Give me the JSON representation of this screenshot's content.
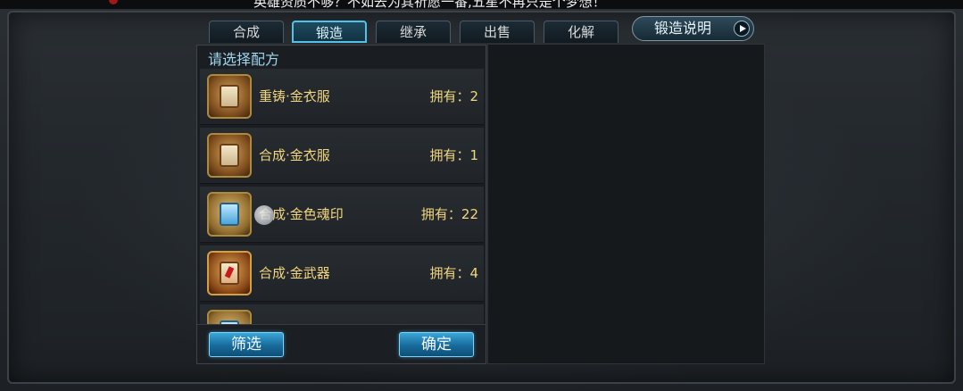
{
  "top_banner": {
    "text": "英雄资质不够？不如去为其祈愿一番,五星不再只是个梦想！"
  },
  "tabs": [
    {
      "label": "合成"
    },
    {
      "label": "锻造"
    },
    {
      "label": "继承"
    },
    {
      "label": "出售"
    },
    {
      "label": "化解"
    }
  ],
  "active_tab": "锻造",
  "explain_button": {
    "label": "锻造说明",
    "icon": "play-arrow-icon"
  },
  "recipe_panel": {
    "title": "请选择配方",
    "items": [
      {
        "name": "重铸·金衣服",
        "owned": "拥有：2",
        "icon": "gold-scroll-icon"
      },
      {
        "name": "合成·金衣服",
        "owned": "拥有：1",
        "icon": "gold-scroll-icon"
      },
      {
        "name": "合成·金色魂印",
        "owned": "拥有：22",
        "icon": "blue-scroll-icon"
      },
      {
        "name": "合成·金武器",
        "owned": "拥有：4",
        "icon": "red-scroll-icon"
      },
      {
        "name": "",
        "owned": "",
        "icon": "blue-scroll-icon"
      }
    ]
  },
  "buttons": {
    "filter": "筛选",
    "confirm": "确定"
  },
  "colors": {
    "accent": "#53c2e8",
    "gold_text": "#f2d67e",
    "title_text": "#9fd6ee"
  }
}
